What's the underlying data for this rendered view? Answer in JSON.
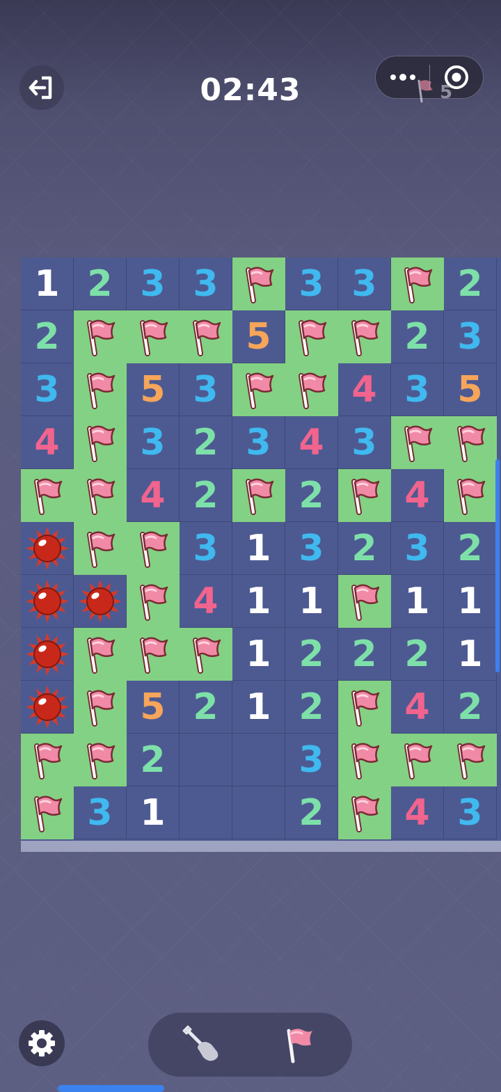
{
  "header": {
    "timer": "02:43",
    "flag_count": "5",
    "exit_icon": "exit-icon",
    "more_icon": "more-dots-icon",
    "close_icon": "target-close-icon"
  },
  "board": {
    "rows": 11,
    "cols": 9,
    "grid": [
      [
        "1",
        "2",
        "3",
        "3",
        "F",
        "3",
        "3",
        "F",
        "2"
      ],
      [
        "2",
        "F",
        "F",
        "F",
        "5",
        "F",
        "F",
        "2",
        "3"
      ],
      [
        "3",
        "F",
        "5",
        "3",
        "F",
        "F",
        "4",
        "3",
        "5"
      ],
      [
        "4",
        "F",
        "3",
        "2",
        "3",
        "4",
        "3",
        "F",
        "F"
      ],
      [
        "F",
        "F",
        "4",
        "2",
        "F",
        "2",
        "F",
        "4",
        "F"
      ],
      [
        "M",
        "F",
        "F",
        "3",
        "1",
        "3",
        "2",
        "3",
        "2"
      ],
      [
        "M",
        "M",
        "F",
        "4",
        "1",
        "1",
        "F",
        "1",
        "1"
      ],
      [
        "M",
        "F",
        "F",
        "F",
        "1",
        "2",
        "2",
        "2",
        "1"
      ],
      [
        "M",
        "F",
        "5",
        "2",
        "1",
        "2",
        "F",
        "4",
        "2"
      ],
      [
        "F",
        "F",
        "2",
        "",
        "",
        "3",
        "F",
        "F",
        "F"
      ],
      [
        "F",
        "3",
        "1",
        "",
        "",
        "2",
        "F",
        "4",
        "3"
      ]
    ],
    "legend": {
      "F": "flag",
      "M": "mine",
      "": "empty"
    },
    "number_colors": {
      "1": "#ffffff",
      "2": "#7ee0a9",
      "3": "#3fb9ef",
      "4": "#f0648e",
      "5": "#f6a55a"
    },
    "colors": {
      "open_cell": "#4d5a91",
      "flag_cell": "#83d184",
      "flag": "#f08aa6",
      "mine": "#c8281a"
    }
  },
  "toolbar": {
    "settings_icon": "gear-icon",
    "modes": [
      {
        "icon": "shovel-icon",
        "name": "dig"
      },
      {
        "icon": "flag-icon",
        "name": "flag"
      }
    ]
  }
}
